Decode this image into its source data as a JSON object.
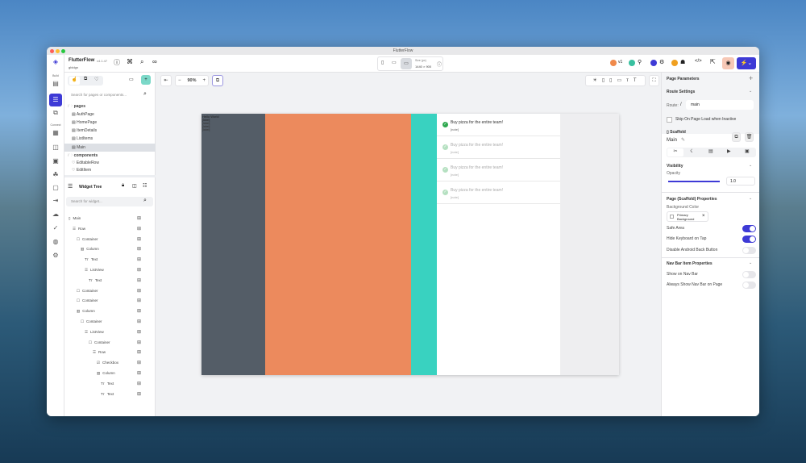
{
  "window": {
    "title": "FlutterFlow"
  },
  "app": {
    "name": "FlutterFlow",
    "version": "v4.1.47",
    "project": "gbldgn"
  },
  "rail": {
    "build": "Build",
    "connect": "Connect"
  },
  "pages_panel": {
    "search_placeholder": "Search for pages or components...",
    "pages_label": "pages",
    "pages": [
      "AuthPage",
      "HomePage",
      "ItemDetails",
      "ListItems",
      "Main"
    ],
    "components_label": "components",
    "components": [
      "EditableRow",
      "EditItem"
    ]
  },
  "widget_tree": {
    "title": "Widget Tree",
    "search_placeholder": "Search for widget...",
    "nodes": [
      {
        "label": "Main",
        "depth": 0
      },
      {
        "label": "Row",
        "depth": 1
      },
      {
        "label": "Container",
        "depth": 2
      },
      {
        "label": "Column",
        "depth": 3
      },
      {
        "label": "Text",
        "depth": 4
      },
      {
        "label": "ListView",
        "depth": 4
      },
      {
        "label": "Text",
        "depth": 5
      },
      {
        "label": "Container",
        "depth": 2
      },
      {
        "label": "Container",
        "depth": 2
      },
      {
        "label": "Column",
        "depth": 2
      },
      {
        "label": "Container",
        "depth": 3
      },
      {
        "label": "ListView",
        "depth": 4
      },
      {
        "label": "Container",
        "depth": 5
      },
      {
        "label": "Row",
        "depth": 6
      },
      {
        "label": "Checkbox",
        "depth": 7
      },
      {
        "label": "Column",
        "depth": 7
      },
      {
        "label": "Text",
        "depth": 8
      },
      {
        "label": "Text",
        "depth": 8
      }
    ]
  },
  "canvas_toolbar": {
    "zoom": "90%"
  },
  "device": {
    "label": "Size (px)",
    "size": "1440 × 900"
  },
  "top_right": {
    "version_badge": "v1"
  },
  "preview": {
    "gray_texts": [
      "Hello World",
      "[label]",
      "[label]",
      "[label]",
      "[label]"
    ],
    "list_items": [
      {
        "title": "Buy pizza for the entire team!",
        "note": "[note]"
      },
      {
        "title": "Buy pizza for the entire team!",
        "note": "[note]"
      },
      {
        "title": "Buy pizza for the entire team!",
        "note": "[note]"
      },
      {
        "title": "Buy pizza for the entire team!",
        "note": "[note]"
      }
    ]
  },
  "props": {
    "page_parameters": "Page Parameters",
    "route_settings": "Route Settings",
    "route_label": "Route:",
    "route_slash": "/",
    "route_value": "main",
    "skip_label": "Skip On Page Load when Inactive",
    "widget_type": "Scaffold",
    "widget_name": "Main",
    "visibility": "Visibility",
    "opacity": "Opacity",
    "opacity_value": "1.0",
    "opacity_fraction": 1.0,
    "page_props": "Page (Scaffold) Properties",
    "bg_color": "Background Color",
    "bg_color_value": "Primary Background",
    "safe_area": "Safe Area",
    "hide_keyboard": "Hide Keyboard on Tap",
    "disable_back": "Disable Android Back Button",
    "nav_bar": "Nav Bar Item Properties",
    "show_nav": "Show on Nav Bar",
    "always_nav": "Always Show Nav Bar on Page"
  },
  "colors": {
    "accent": "#3e3ad6",
    "gray_col": "#545d67",
    "orange_col": "#ec8a5d",
    "teal_col": "#39d2c0"
  }
}
